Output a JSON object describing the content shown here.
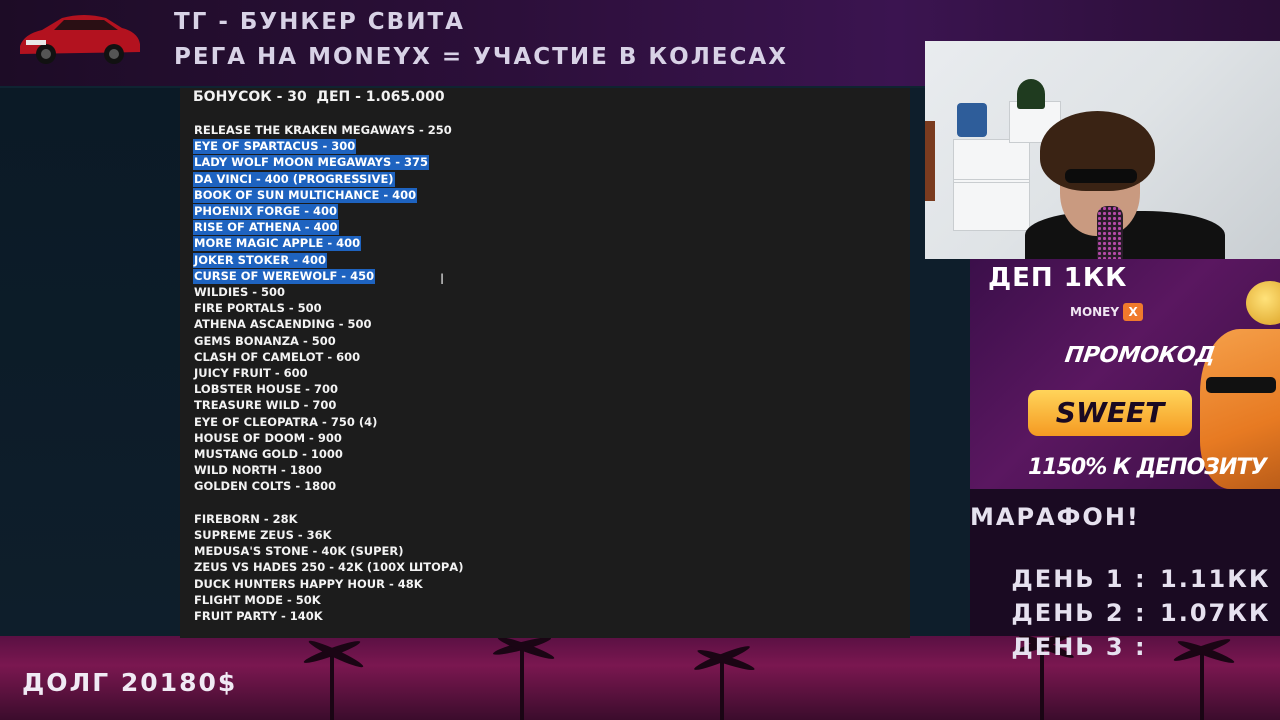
{
  "header": {
    "line1": "ТГ - БУНКЕР СВИТА",
    "line2": "РЕГА НА MONEYX = УЧАСТИЕ В КОЛЕСАХ"
  },
  "document": {
    "title": "БОНУСОК - 30  ДЕП - 1.065.000",
    "lines": [
      {
        "text": "RELEASE THE KRAKEN MEGAWAYS - 250",
        "selected": false
      },
      {
        "text": "EYE OF SPARTACUS - 300",
        "selected": true
      },
      {
        "text": "LADY WOLF MOON MEGAWAYS - 375",
        "selected": true
      },
      {
        "text": "DA VINCI - 400 (PROGRESSIVE)",
        "selected": true
      },
      {
        "text": "BOOK OF SUN MULTICHANCE - 400",
        "selected": true
      },
      {
        "text": "PHOENIX FORGE - 400",
        "selected": true
      },
      {
        "text": "RISE OF ATHENA - 400",
        "selected": true
      },
      {
        "text": "MORE MAGIC APPLE - 400",
        "selected": true
      },
      {
        "text": "JOKER STOKER - 400",
        "selected": true
      },
      {
        "text": "CURSE OF WEREWOLF - 450",
        "selected": true
      },
      {
        "text": "WILDIES - 500",
        "selected": false
      },
      {
        "text": "FIRE PORTALS - 500",
        "selected": false
      },
      {
        "text": "ATHENA ASCAENDING - 500",
        "selected": false
      },
      {
        "text": "GEMS BONANZA - 500",
        "selected": false
      },
      {
        "text": "CLASH OF CAMELOT - 600",
        "selected": false
      },
      {
        "text": "JUICY FRUIT - 600",
        "selected": false
      },
      {
        "text": "LOBSTER HOUSE - 700",
        "selected": false
      },
      {
        "text": "TREASURE WILD - 700",
        "selected": false
      },
      {
        "text": "EYE OF CLEOPATRA - 750 (4)",
        "selected": false
      },
      {
        "text": "HOUSE OF DOOM - 900",
        "selected": false
      },
      {
        "text": "MUSTANG GOLD - 1000",
        "selected": false
      },
      {
        "text": "WILD NORTH - 1800",
        "selected": false
      },
      {
        "text": "GOLDEN COLTS - 1800",
        "selected": false
      },
      {
        "text": "",
        "selected": false
      },
      {
        "text": "FIREBORN - 28K",
        "selected": false
      },
      {
        "text": "SUPREME ZEUS - 36K",
        "selected": false
      },
      {
        "text": "MEDUSA'S STONE - 40K (SUPER)",
        "selected": false
      },
      {
        "text": "ZEUS VS HADES 250 - 42K (100X ШТОРА)",
        "selected": false
      },
      {
        "text": "DUCK HUNTERS HAPPY HOUR - 48K",
        "selected": false
      },
      {
        "text": "FLIGHT MODE - 50K",
        "selected": false
      },
      {
        "text": "FRUIT PARTY - 140K",
        "selected": false
      }
    ]
  },
  "promo": {
    "deposit": "ДЕП 1КК",
    "brand": "MONEY",
    "brand_mark": "X",
    "code_label": "ПРОМОКОД",
    "code": "SWEET",
    "bonus": "1150% К ДЕПОЗИТУ"
  },
  "marathon": {
    "title": "МАРАФОН!",
    "days": [
      {
        "label": "ДЕНЬ 1 :",
        "value": "1.11КК"
      },
      {
        "label": "ДЕНЬ 2 :",
        "value": "1.07КК"
      },
      {
        "label": "ДЕНЬ 3 :",
        "value": ""
      }
    ]
  },
  "debt": "ДОЛГ 20180$",
  "colors": {
    "selection": "#1e63c0",
    "document_bg": "#1c1c1c",
    "promo_button": "#f5b236"
  },
  "icons": {
    "cursor": "text-cursor-icon",
    "logo": "red-car-logo"
  }
}
